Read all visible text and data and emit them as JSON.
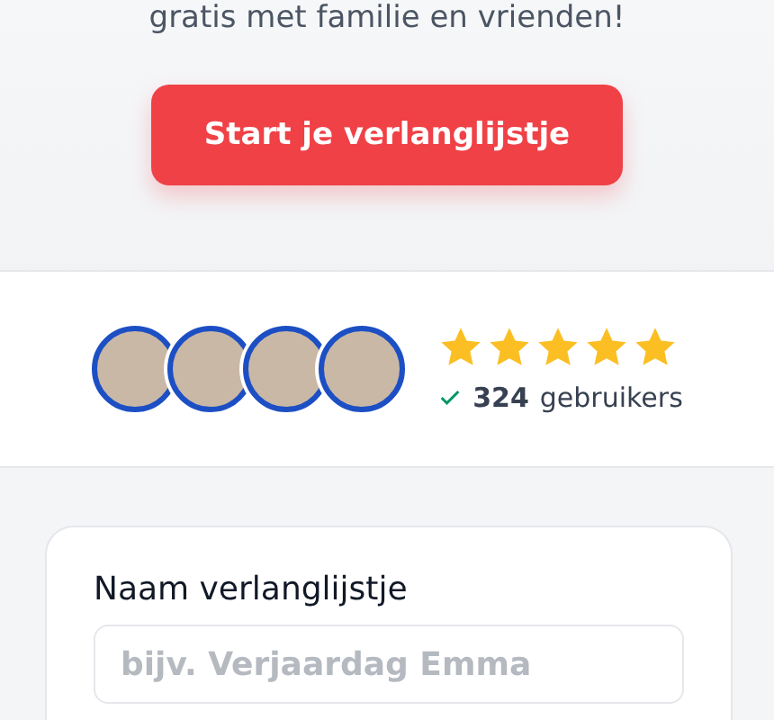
{
  "hero": {
    "subtitle": "gratis met familie en vrienden!",
    "cta": "Start je verlanglijstje"
  },
  "social_proof": {
    "stars": 5,
    "users_count": "324",
    "users_label": "gebruikers"
  },
  "form": {
    "label": "Naam verlanglijstje",
    "placeholder": "bijv. Verjaardag Emma"
  }
}
